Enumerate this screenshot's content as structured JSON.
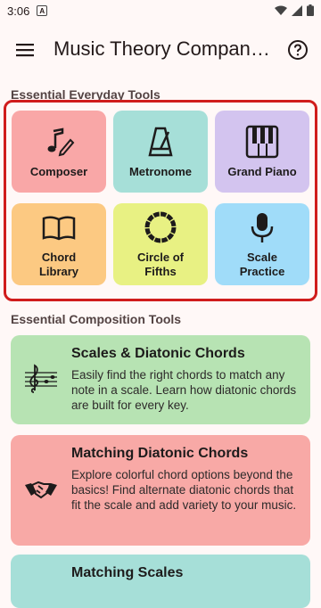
{
  "status": {
    "time": "3:06",
    "notif": "A"
  },
  "app_bar": {
    "title": "Music Theory Companion",
    "menu_icon": "hamburger-menu-icon",
    "help_icon": "help-circle-icon"
  },
  "sections": {
    "everyday": "Essential Everyday Tools",
    "composition": "Essential Composition Tools"
  },
  "tools": [
    {
      "label": "Composer",
      "icon": "music-note-pencil-icon",
      "color": "#f9a7a7"
    },
    {
      "label": "Metronome",
      "icon": "metronome-icon",
      "color": "#a6dfd8"
    },
    {
      "label": "Grand Piano",
      "icon": "piano-keys-icon",
      "color": "#d3c4ef"
    },
    {
      "label": "Chord Library",
      "icon": "book-icon",
      "color": "#fcc982"
    },
    {
      "label": "Circle of Fifths",
      "icon": "circle-dashed-icon",
      "color": "#e8f183"
    },
    {
      "label": "Scale Practice",
      "icon": "microphone-icon",
      "color": "#a0dcf9"
    }
  ],
  "cards": [
    {
      "title": "Scales & Diatonic Chords",
      "desc": "Easily find the right chords to match any note in a scale. Learn how diatonic chords are built for every key.",
      "icon": "treble-clef-staff-icon",
      "color": "#b7e3b3"
    },
    {
      "title": "Matching Diatonic Chords",
      "desc": "Explore colorful chord options beyond the basics! Find alternate diatonic chords that fit the scale and add variety to your music.",
      "icon": "handshake-icon",
      "color": "#f8a9a6"
    },
    {
      "title": "Matching Scales",
      "desc": "",
      "icon": "scales-icon",
      "color": "#a6dfd8"
    }
  ]
}
